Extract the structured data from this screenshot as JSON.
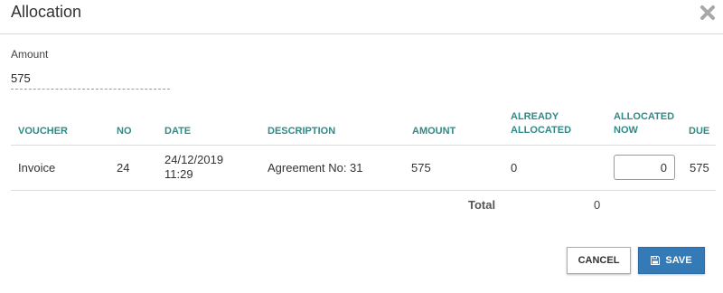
{
  "dialog": {
    "title": "Allocation"
  },
  "amount": {
    "label": "Amount",
    "value": "575"
  },
  "table": {
    "headers": {
      "voucher": "VOUCHER",
      "no": "NO",
      "date": "DATE",
      "description": "DESCRIPTION",
      "amount": "AMOUNT",
      "already_allocated_1": "ALREADY",
      "already_allocated_2": "ALLOCATED",
      "allocated_now_1": "ALLOCATED",
      "allocated_now_2": "NOW",
      "due": "DUE"
    },
    "rows": [
      {
        "voucher": "Invoice",
        "no": "24",
        "date_day": "24/12/2019",
        "date_time": "11:29",
        "description": "Agreement No: 31",
        "amount": "575",
        "already_allocated": "0",
        "allocated_now": "0",
        "due": "575"
      }
    ],
    "total_label": "Total",
    "total_value": "0"
  },
  "buttons": {
    "cancel": "CANCEL",
    "save": "SAVE"
  },
  "icons": {
    "close": "close-icon",
    "save": "floppy-disk-icon"
  },
  "colors": {
    "header_text": "#2e8b85",
    "primary": "#337ab7"
  }
}
